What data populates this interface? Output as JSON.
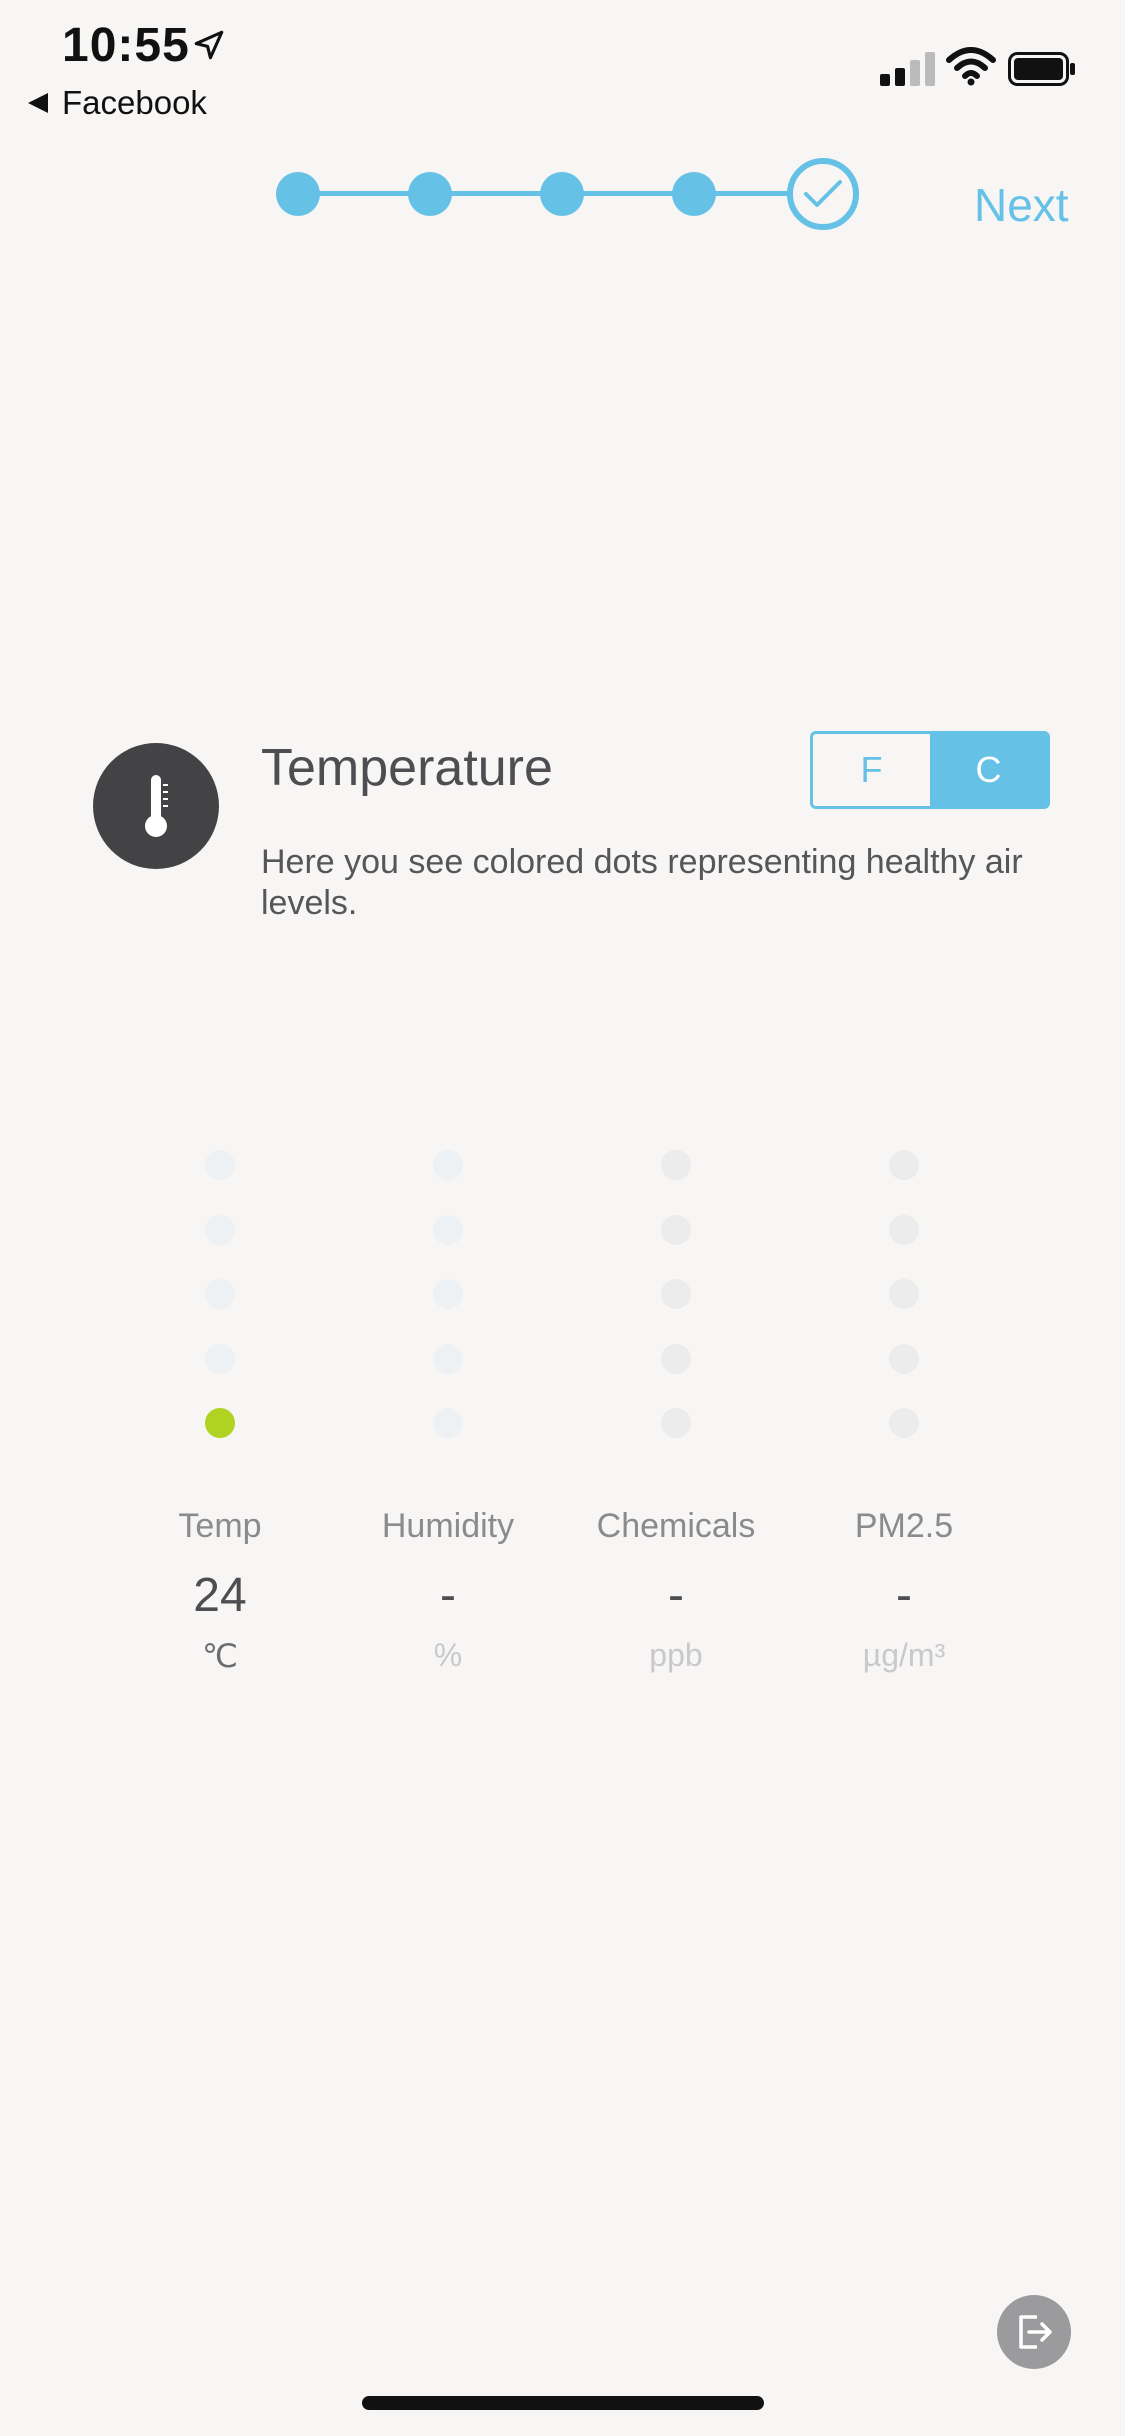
{
  "status_bar": {
    "time": "10:55",
    "back_app": "Facebook"
  },
  "onboarding": {
    "next_label": "Next",
    "steps_total": 5,
    "current_step": 5
  },
  "info": {
    "title": "Temperature",
    "description": "Here you see colored dots representing healthy air levels.",
    "unit_toggle": {
      "options": [
        "F",
        "C"
      ],
      "selected": "C"
    }
  },
  "metrics": [
    {
      "label": "Temp",
      "value": "24",
      "unit": "℃",
      "level": 1
    },
    {
      "label": "Humidity",
      "value": "-",
      "unit": "%",
      "level": 0
    },
    {
      "label": "Chemicals",
      "value": "-",
      "unit": "ppb",
      "level": 0
    },
    {
      "label": "PM2.5",
      "value": "-",
      "unit": "µg/m³",
      "level": 0
    }
  ],
  "colors": {
    "accent": "#66c1e6",
    "good_dot": "#afd320",
    "dot_idle_blue": "#eef1f4",
    "dot_idle_gray": "#ececec"
  },
  "icons": {
    "thermometer": "thermometer-icon",
    "exit": "exit-icon"
  }
}
